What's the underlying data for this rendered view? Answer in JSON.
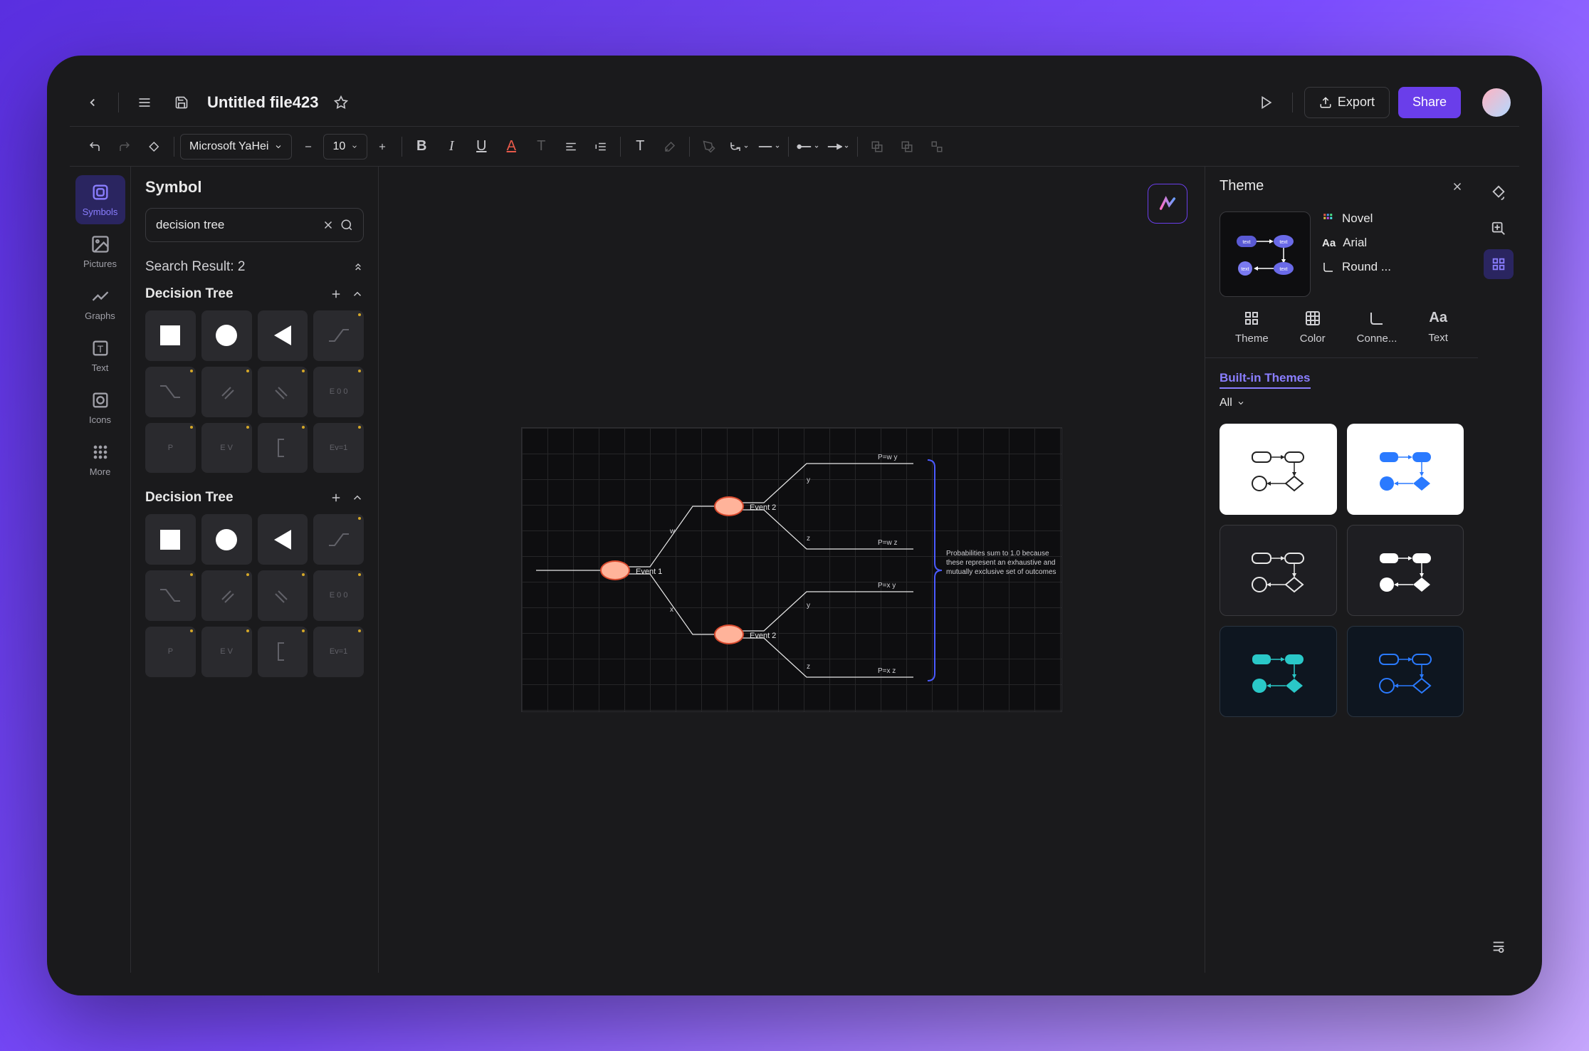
{
  "header": {
    "title": "Untitled file423",
    "export_label": "Export",
    "share_label": "Share"
  },
  "toolbar": {
    "font_family": "Microsoft YaHei",
    "font_size": "10"
  },
  "left_rail": {
    "items": [
      {
        "label": "Symbols"
      },
      {
        "label": "Pictures"
      },
      {
        "label": "Graphs"
      },
      {
        "label": "Text"
      },
      {
        "label": "Icons"
      },
      {
        "label": "More"
      }
    ]
  },
  "symbol_panel": {
    "title": "Symbol",
    "search_value": "decision tree",
    "search_result_label": "Search Result: 2",
    "sections": [
      {
        "label": "Decision Tree"
      },
      {
        "label": "Decision Tree"
      }
    ]
  },
  "canvas": {
    "event1": "Event 1",
    "event2a": "Event 2",
    "event2b": "Event 2",
    "w": "w",
    "x": "x",
    "y1": "y",
    "z1": "z",
    "y2": "y",
    "z2": "z",
    "p_wy": "P=w y",
    "p_wz": "P=w z",
    "p_xy": "P=x y",
    "p_xz": "P=x z",
    "annotation": "Probabilities sum to 1.0 because these represent an exhaustive and mutually exclusive set of outcomes"
  },
  "theme_panel": {
    "title": "Theme",
    "current": {
      "name": "Novel",
      "font": "Arial",
      "connector": "Round ..."
    },
    "tabs": [
      {
        "label": "Theme"
      },
      {
        "label": "Color"
      },
      {
        "label": "Conne..."
      },
      {
        "label": "Text"
      }
    ],
    "builtin_label": "Built-in Themes",
    "all_label": "All"
  }
}
